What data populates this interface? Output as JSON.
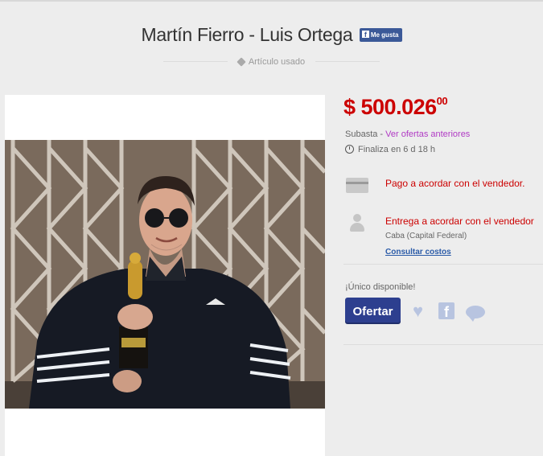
{
  "header": {
    "title": "Martín Fierro - Luis Ortega",
    "like_label": "Me gusta",
    "condition": "Artículo usado"
  },
  "listing": {
    "price_main": "$ 500.026",
    "price_cents": "00",
    "sale_type": "Subasta - ",
    "see_offers_link": "Ver ofertas anteriores",
    "ends_in": "Finaliza en 6 d 18 h",
    "payment": "Pago a acordar con el vendedor.",
    "delivery": "Entrega a acordar con el vendedor",
    "location": "Caba (Capital Federal)",
    "shipping_costs_link": "Consultar costos",
    "availability": "¡Único disponible!",
    "offer_button": "Ofertar"
  },
  "colors": {
    "price": "#cc0000",
    "link": "#b03ac4",
    "button": "#2d3f8f",
    "page_background": "#ededed"
  },
  "icons": {
    "condition": "tag-icon",
    "ends": "clock-icon",
    "payment": "credit-card-icon",
    "delivery": "person-icon",
    "favorite": "heart-icon",
    "share": "facebook-icon",
    "question": "speech-bubble-icon"
  }
}
